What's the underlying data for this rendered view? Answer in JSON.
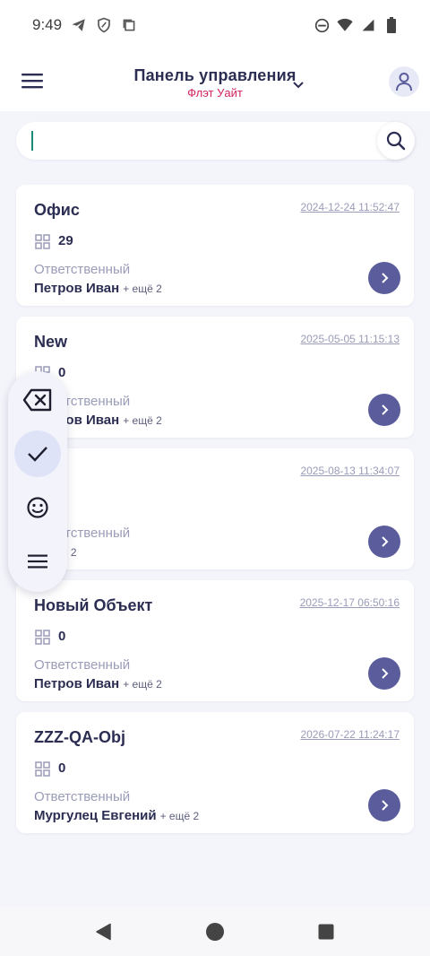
{
  "status_bar": {
    "time": "9:49",
    "icons_left": [
      "telegram-icon",
      "shield-icon",
      "copy-icon"
    ],
    "icons_right": [
      "do-not-disturb-icon",
      "wifi-icon",
      "signal-icon",
      "battery-icon"
    ]
  },
  "header": {
    "title": "Панель управления",
    "subtitle": "Флэт Уайт",
    "subtitle_color": "#d2245e"
  },
  "search": {
    "value": "",
    "placeholder": ""
  },
  "cards": [
    {
      "name": "Офис",
      "date": "2024-12-24 11:52:47",
      "count": "29",
      "resp_label": "Ответственный",
      "resp_name": "Петров Иван",
      "resp_more": "+ ещё 2"
    },
    {
      "name": "New",
      "date": "2025-05-05 11:15:13",
      "count": "0",
      "resp_label": "Ответственный",
      "resp_name": "Петров Иван",
      "resp_more": "+ ещё 2"
    },
    {
      "name": "",
      "date": "2025-08-13 11:34:07",
      "count": "",
      "resp_label": "Ответственный",
      "resp_name": "",
      "resp_more": "+ ещё 2"
    },
    {
      "name": "Новый Объект",
      "date": "2025-12-17 06:50:16",
      "count": "0",
      "resp_label": "Ответственный",
      "resp_name": "Петров Иван",
      "resp_more": "+ ещё 2"
    },
    {
      "name": "ZZZ-QA-Obj",
      "date": "2026-07-22 11:24:17",
      "count": "0",
      "resp_label": "Ответственный",
      "resp_name": "Мургулец Евгений",
      "resp_more": "+ ещё 2"
    }
  ],
  "float_toolbar": {
    "buttons": [
      "backspace-icon",
      "check-icon",
      "emoji-icon",
      "menu-icon"
    ],
    "active": "check-icon"
  },
  "colors": {
    "accent": "#5a5c9c",
    "background": "#f4f5fb",
    "title": "#2b2d52",
    "muted": "#9a9cb8"
  }
}
